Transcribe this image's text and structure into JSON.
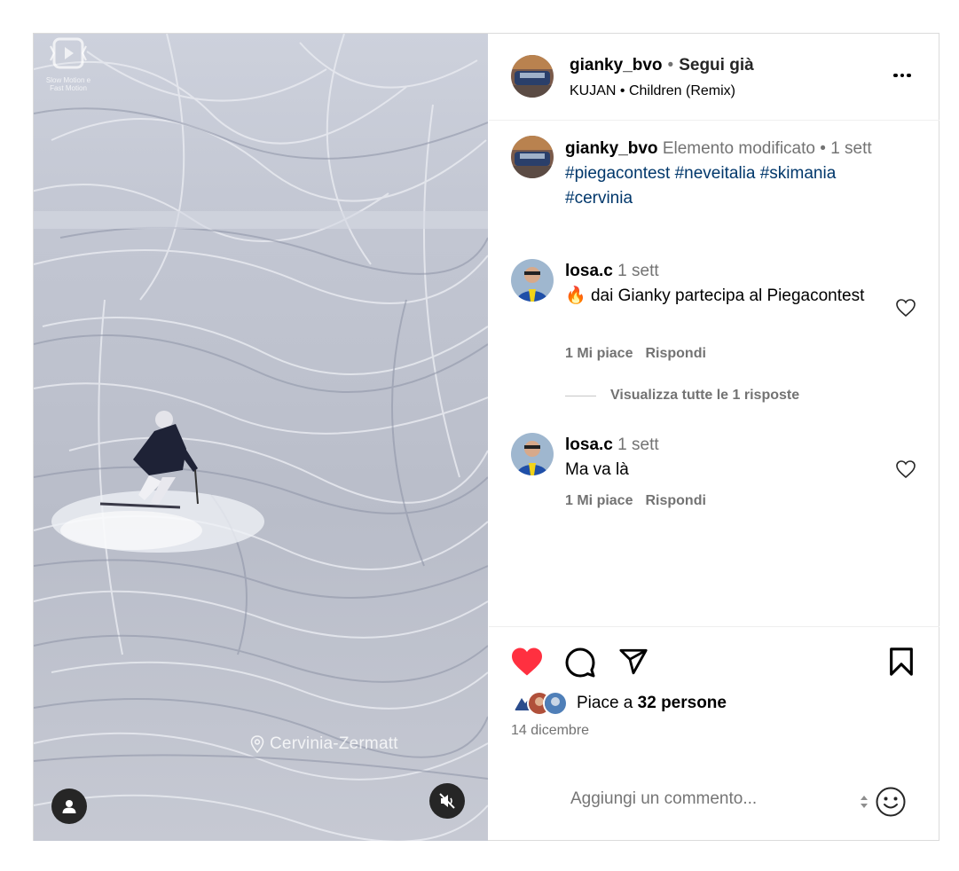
{
  "media": {
    "watermark": {
      "line1": "Slow Motion e",
      "line2": "Fast Motion"
    },
    "location": "Cervinia-Zermatt",
    "icons": {
      "user_tag": "user-icon",
      "mute": "speaker-muted-icon",
      "location": "location-pin-icon"
    }
  },
  "header": {
    "username": "gianky_bvo",
    "separator": "•",
    "follow_label": "Segui già",
    "audio_artist": "KUJAN",
    "audio_title": "Children (Remix)"
  },
  "caption": {
    "username": "gianky_bvo",
    "edited_label": "Elemento modificato",
    "separator": "•",
    "time": "1 sett",
    "hashtags": [
      "#piegacontest",
      "#neveitalia",
      "#skimania",
      "#cervinia"
    ]
  },
  "comments": [
    {
      "username": "losa.c",
      "time": "1 sett",
      "emoji": "🔥",
      "text": " dai Gianky partecipa al Piegacontest",
      "likes": "1 Mi piace",
      "reply": "Rispondi"
    },
    {
      "username": "losa.c",
      "time": "1 sett",
      "emoji": "",
      "text": "Ma va là",
      "likes": "1 Mi piace",
      "reply": "Rispondi"
    }
  ],
  "view_replies": "Visualizza tutte le 1 risposte",
  "likes_summary": {
    "prefix": "Piace a",
    "count": "32 persone"
  },
  "date": "14 dicembre",
  "add_comment": {
    "placeholder": "Aggiungi un commento..."
  },
  "colors": {
    "liked": "#ff3040",
    "hashtag": "#00376b",
    "secondary": "#737373"
  }
}
